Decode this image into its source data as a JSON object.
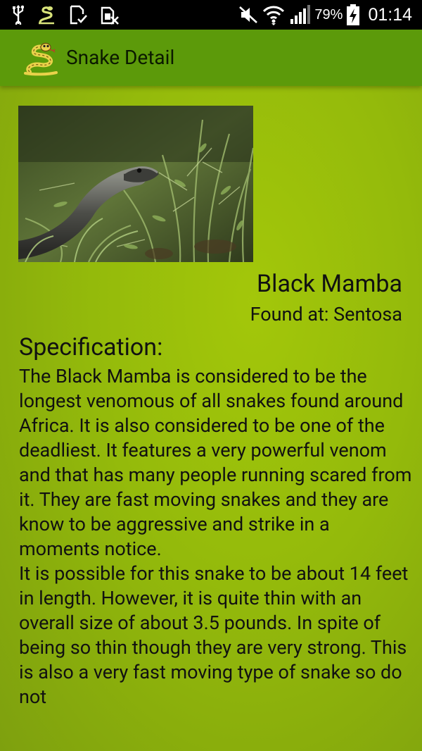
{
  "status_bar": {
    "battery_percent": "79%",
    "time": "01:14",
    "icons": [
      "usb-icon",
      "snake-app-notification-icon",
      "download-done-icon",
      "no-sim-icon",
      "mute-icon",
      "wifi-icon",
      "signal-icon",
      "battery-charging-icon"
    ]
  },
  "action_bar": {
    "title": "Snake Detail",
    "icon": "snake-app-icon"
  },
  "snake": {
    "name": "Black Mamba",
    "location": "Found at: Sentosa",
    "image": "black-mamba-photo"
  },
  "specification": {
    "heading": "Specification:",
    "paragraphs": [
      "The Black Mamba is considered to be the longest venomous of all snakes found around Africa. It is also considered to be one of the deadliest. It features a very powerful venom and that has many people running scared from it. They are fast moving snakes and they are know to be aggressive and strike in a moments notice.",
      "It is possible for this snake to be about 14 feet in length. However, it is quite thin with an overall size of about 3.5 pounds. In spite of being so thin though they are very strong. This is also a very fast moving type of snake so do not"
    ]
  },
  "colors": {
    "background": "#94ba0b",
    "action_bar": "#5c9a0a",
    "status_bar": "#000000",
    "text": "#111111"
  }
}
